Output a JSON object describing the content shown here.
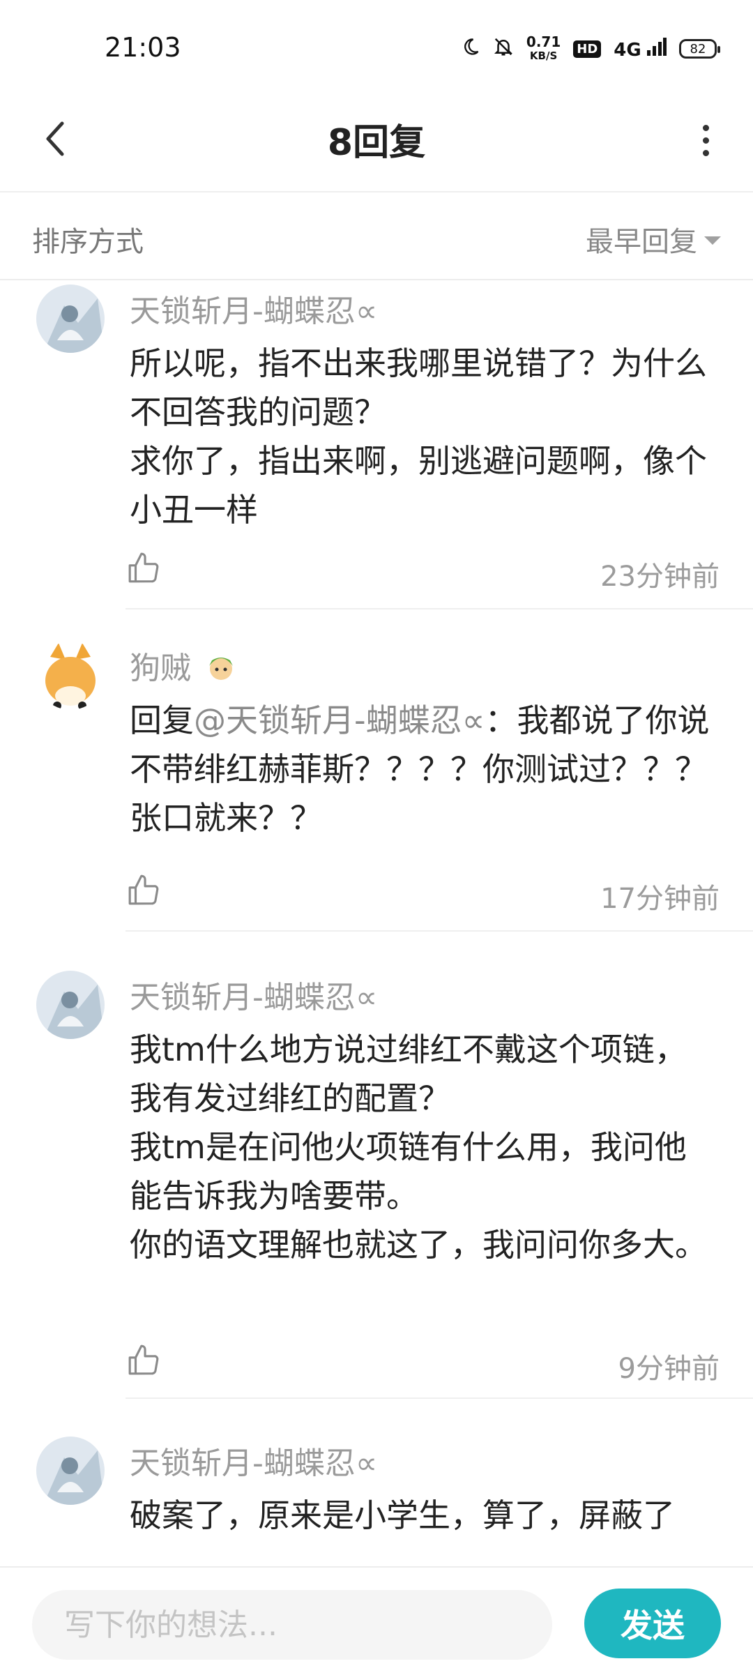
{
  "status_bar": {
    "time": "21:03",
    "net_speed_value": "0.71",
    "net_speed_unit": "KB/S",
    "hd_label": "HD",
    "signal_label": "4G",
    "battery": "82"
  },
  "header": {
    "title": "8回复"
  },
  "sort": {
    "label": "排序方式",
    "value": "最早回复"
  },
  "replies": [
    {
      "name": "天锁斩月-蝴蝶忍∝",
      "content": "所以呢，指不出来我哪里说错了？为什么不回答我的问题？\n求你了，指出来啊，别逃避问题啊，像个小丑一样",
      "time": "23分钟前"
    },
    {
      "name": "狗贼",
      "content_prefix": "回复",
      "mention": "@天锁斩月-蝴蝶忍∝",
      "content": "：我都说了你说不带绯红赫菲斯？？？？你测试过？？？张口就来？？",
      "time": "17分钟前"
    },
    {
      "name": "天锁斩月-蝴蝶忍∝",
      "content": "我tm什么地方说过绯红不戴这个项链，我有发过绯红的配置？\n我tm是在问他火项链有什么用，我问他能告诉我为啥要带。\n你的语文理解也就这了，我问问你多大。",
      "time": "9分钟前"
    },
    {
      "name": "天锁斩月-蝴蝶忍∝",
      "content": "破案了，原来是小学生，算了，屏蔽了"
    }
  ],
  "composer": {
    "placeholder": "写下你的想法...",
    "send_label": "发送"
  },
  "colors": {
    "accent": "#1fb7c0",
    "meta_gray": "#9a9a9a"
  }
}
